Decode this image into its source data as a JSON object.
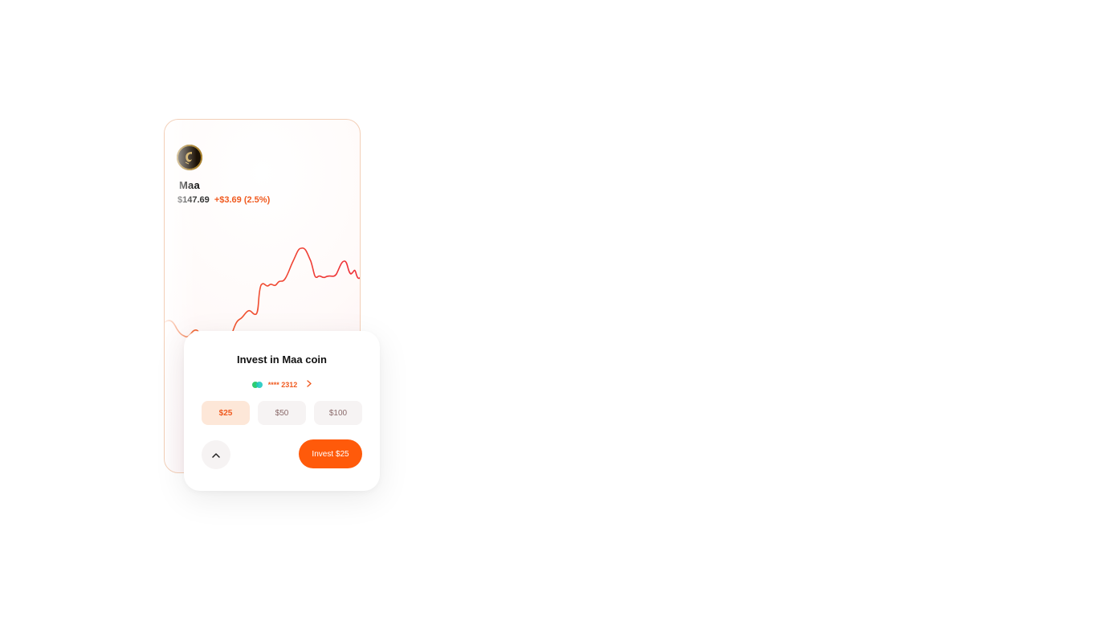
{
  "coin": {
    "name": "Maa",
    "price": "$147.69",
    "change": "+$3.69 (2.5%)",
    "logo_icon": "maa-coin-logo-icon"
  },
  "colors": {
    "accent": "#ff5a0a",
    "chart_line": "#f0302a",
    "positive_text": "#f05a1f",
    "card_border": "#f3cfb7"
  },
  "invest": {
    "title": "Invest in Maa coin",
    "card_masked": "**** 2312",
    "card_icon": "payment-card-icon",
    "chevron_icon": "chevron-right-icon",
    "amounts": [
      "$25",
      "$50",
      "$100"
    ],
    "selected_amount": "$25",
    "collapse_icon": "chevron-up-icon",
    "cta_label": "Invest $25"
  }
}
